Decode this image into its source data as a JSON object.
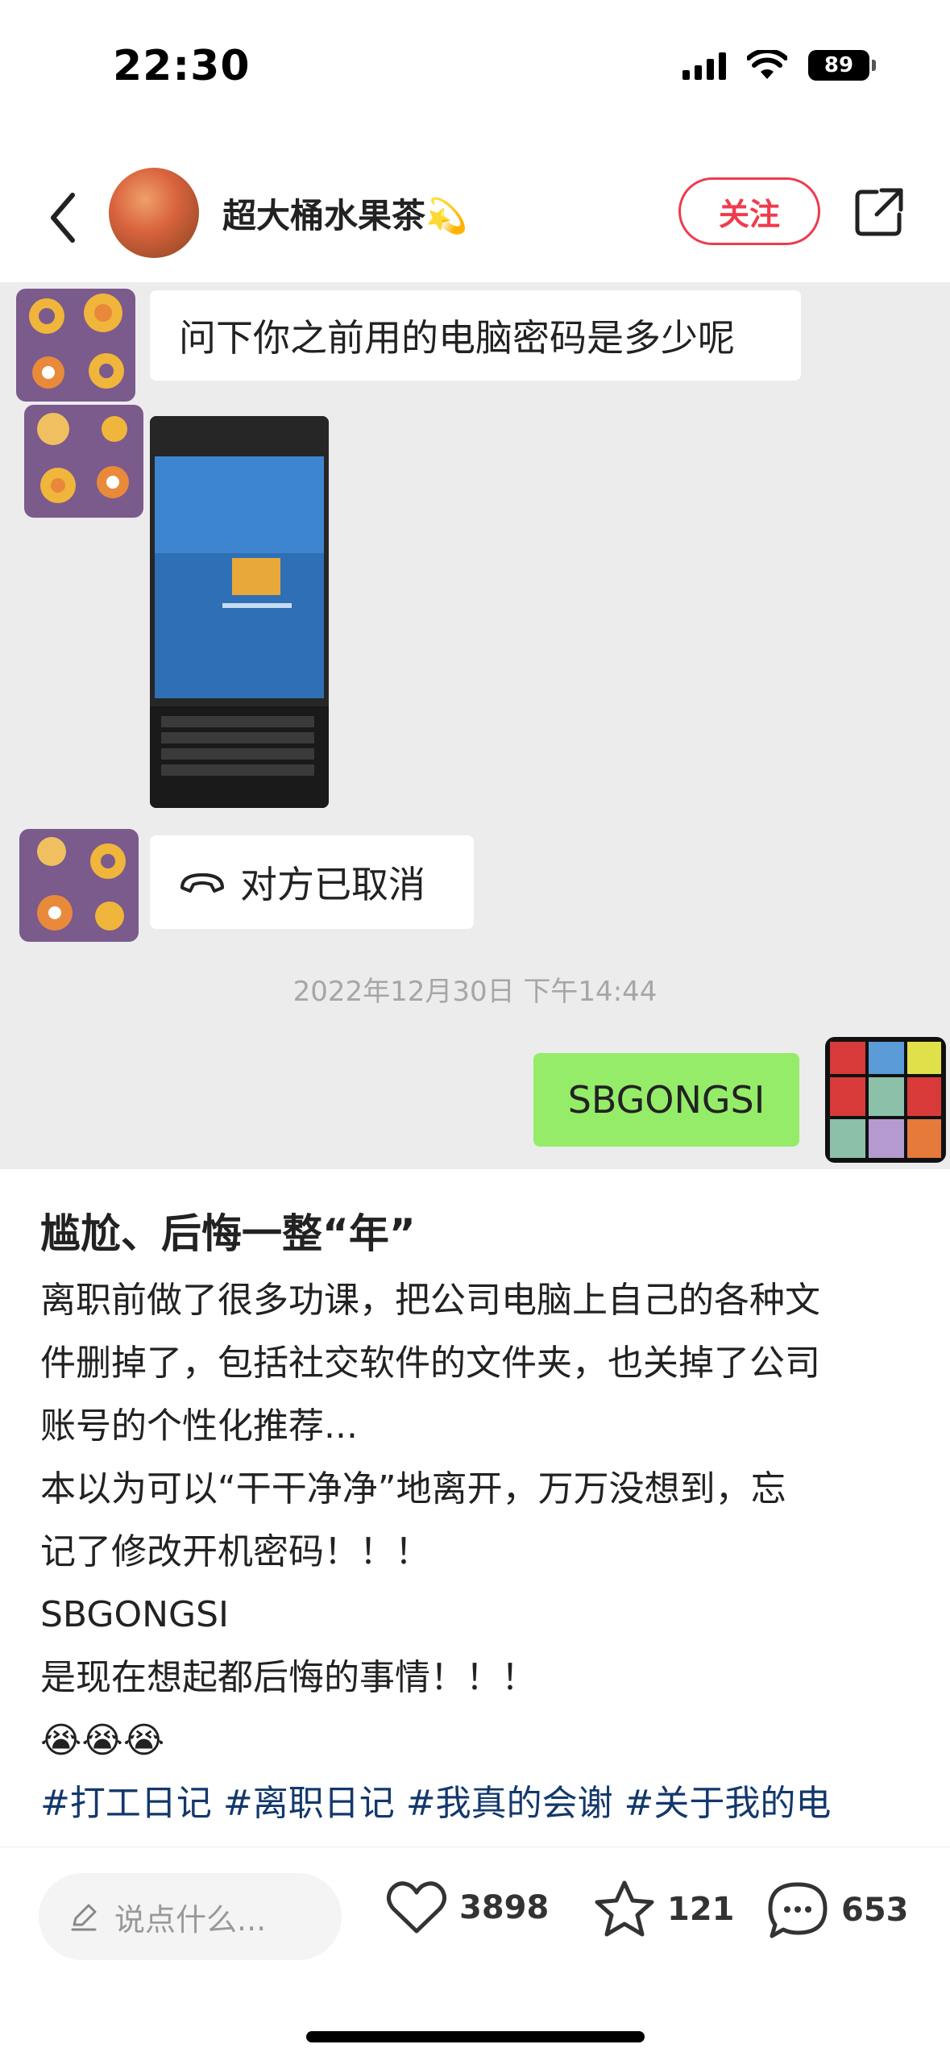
{
  "status_bar": {
    "time": "22:30",
    "battery": "89"
  },
  "header": {
    "username": "超大桶水果茶💫",
    "follow_label": "关注"
  },
  "chat": {
    "messages": [
      {
        "type": "text",
        "side": "left",
        "text": "问下你之前用的电脑密码是多少呢"
      },
      {
        "type": "image",
        "side": "left",
        "description_icon": "photo-icon"
      },
      {
        "type": "call",
        "side": "left",
        "text": "对方已取消"
      },
      {
        "type": "text",
        "side": "right",
        "text": "SBGONGSI"
      }
    ],
    "timestamp": "2022年12月30日 下午14:44"
  },
  "post": {
    "title": "尴尬、后悔一整“年”",
    "lines": [
      "离职前做了很多功课，把公司电脑上自己的各种文",
      "件删掉了，包括社交软件的文件夹，也关掉了公司",
      "账号的个性化推荐...",
      "本以为可以“干干净净”地离开，万万没想到，忘",
      "记了修改开机密码！！！",
      "SBGONGSI",
      "是现在想起都后悔的事情！！！"
    ],
    "emoji_line": "😭😭😭",
    "tags": "#打工日记 #离职日记 #我真的会谢 #关于我的电"
  },
  "bottom_bar": {
    "comment_placeholder": "说点什么...",
    "likes": "3898",
    "favorites": "121",
    "comments": "653"
  },
  "colors": {
    "accent_red": "#ef3b4d",
    "chat_bg": "#ececec",
    "bubble_green": "#95ec69",
    "tag_blue": "#13386c"
  }
}
